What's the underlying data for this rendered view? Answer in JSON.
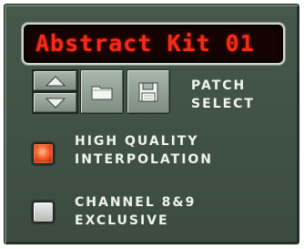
{
  "display": {
    "patch_name": "Abstract Kit 01"
  },
  "patch": {
    "label_line1": "PATCH",
    "label_line2": "SELECT",
    "prev_icon": "arrow-up-icon",
    "next_icon": "arrow-down-icon",
    "browse_icon": "folder-icon",
    "save_icon": "floppy-disk-icon"
  },
  "high_quality": {
    "label_line1": "HIGH QUALITY",
    "label_line2": "INTERPOLATION",
    "enabled": true
  },
  "channel_exclusive": {
    "label_line1": "CHANNEL 8&9",
    "label_line2": "EXCLUSIVE",
    "enabled": false
  },
  "colors": {
    "panel": "#425448",
    "display_bg": "#150303",
    "display_text": "#f32b1a",
    "led_on": "#ff6a35",
    "led_off": "#d8dad8",
    "label": "#f1f4f1"
  }
}
